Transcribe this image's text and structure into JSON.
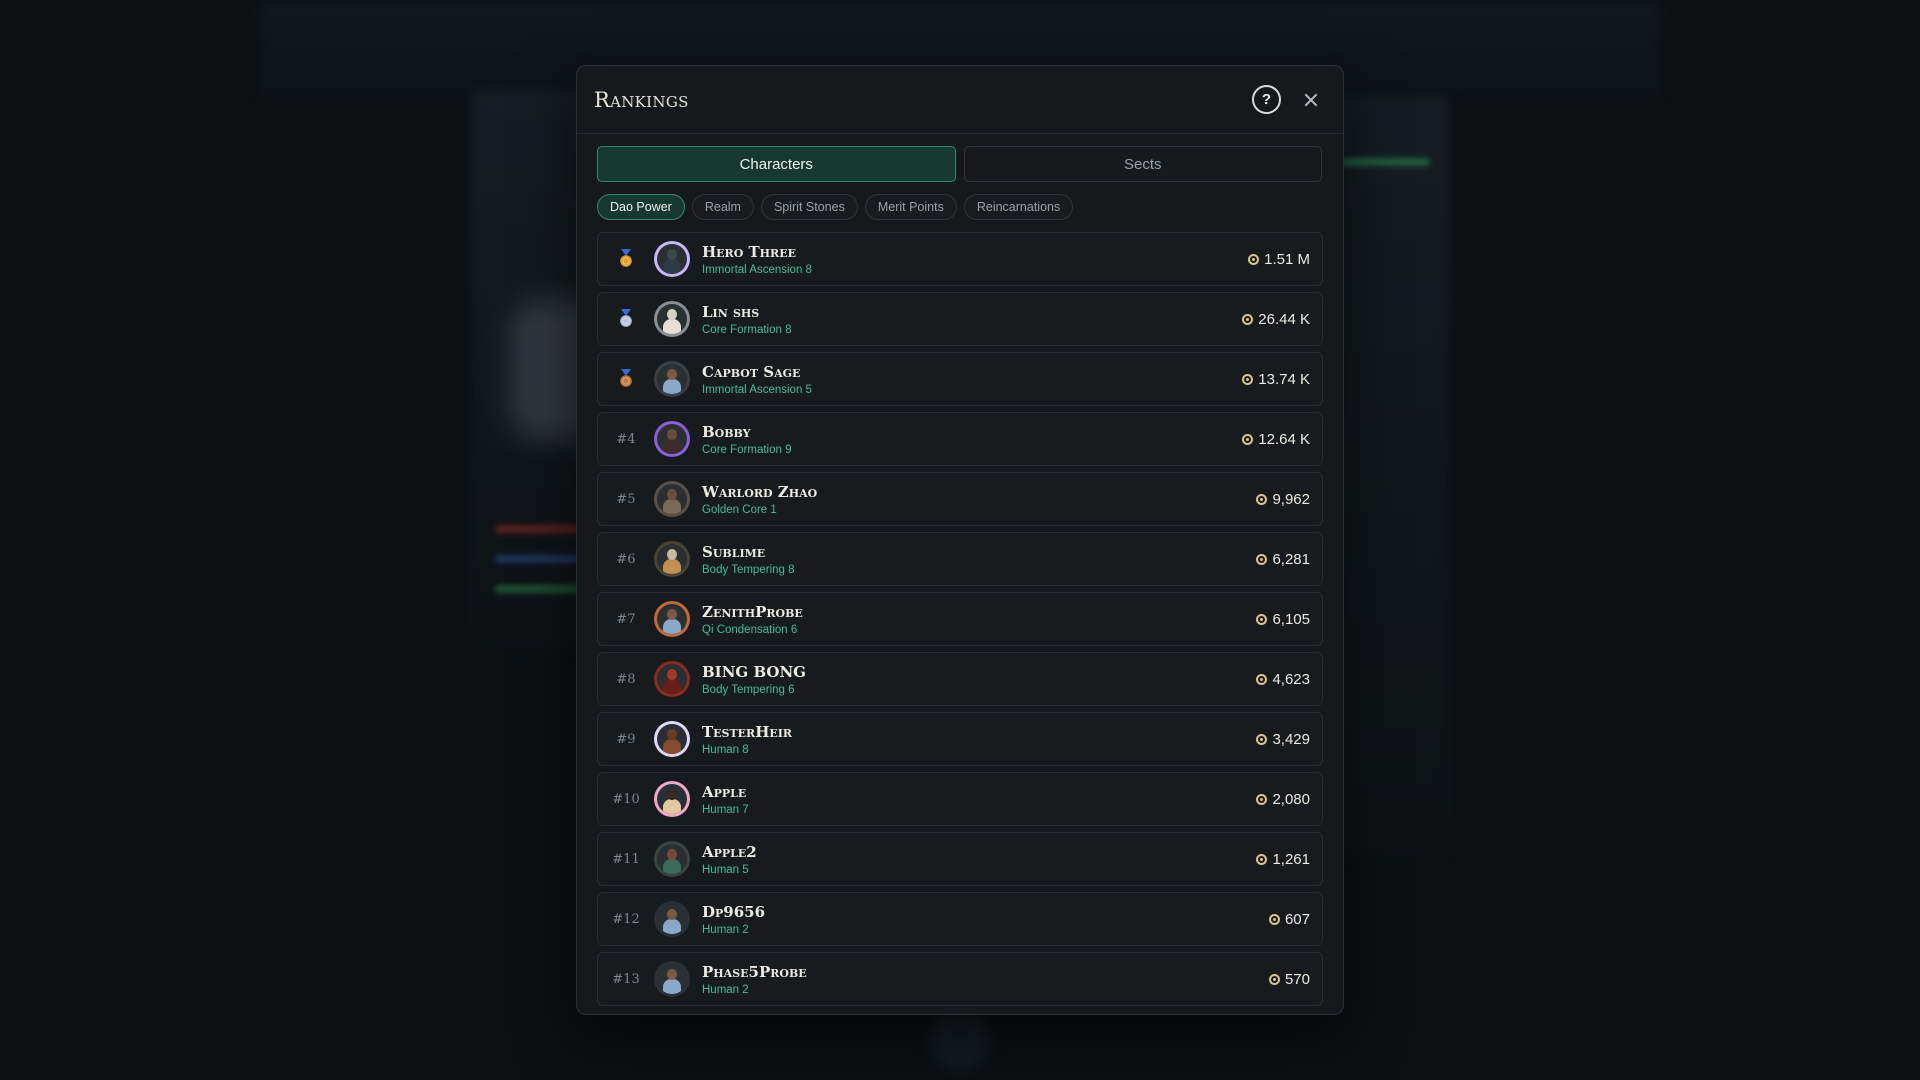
{
  "modal": {
    "title": "Rankings",
    "help_label": "?"
  },
  "main_tabs": [
    {
      "label": "Characters",
      "active": true
    },
    {
      "label": "Sects",
      "active": false
    }
  ],
  "sub_tabs": [
    {
      "label": "Dao Power",
      "active": true
    },
    {
      "label": "Realm",
      "active": false
    },
    {
      "label": "Spirit Stones",
      "active": false
    },
    {
      "label": "Merit Points",
      "active": false
    },
    {
      "label": "Reincarnations",
      "active": false
    }
  ],
  "colors": {
    "accent": "#2f8a6c",
    "realm_text": "#3fbf8f",
    "gold_medal": "#e0a030",
    "silver_medal": "#b8c4d8",
    "bronze_medal": "#c07840"
  },
  "rankings": [
    {
      "rank": "",
      "medal": "gold",
      "name": "Hero Three",
      "realm": "Immortal Ascension 8",
      "power": "1.51 M",
      "ring": "#c8b8ff",
      "head": "#3a4a4a",
      "body": "#2e3a46"
    },
    {
      "rank": "",
      "medal": "silver",
      "name": "Lin shs",
      "realm": "Core Formation 8",
      "power": "26.44 K",
      "ring": "#8a8f94",
      "head": "#d8d2c4",
      "body": "#e4e0d6"
    },
    {
      "rank": "",
      "medal": "bronze",
      "name": "Capbot Sage",
      "realm": "Immortal Ascension 5",
      "power": "13.74 K",
      "ring": "#3a3f44",
      "head": "#7a5a46",
      "body": "#8aa8c8"
    },
    {
      "rank": "#4",
      "medal": "",
      "name": "Bobby",
      "realm": "Core Formation 9",
      "power": "12.64 K",
      "ring": "#8a60d8",
      "head": "#6a4a3a",
      "body": "#3e2c2a"
    },
    {
      "rank": "#5",
      "medal": "",
      "name": "Warlord Zhao",
      "realm": "Golden Core 1",
      "power": "9,962",
      "ring": "#5a5048",
      "head": "#6a5040",
      "body": "#7a6a58"
    },
    {
      "rank": "#6",
      "medal": "",
      "name": "Sublime",
      "realm": "Body Tempering 8",
      "power": "6,281",
      "ring": "#4a4438",
      "head": "#c8b8a0",
      "body": "#c09050"
    },
    {
      "rank": "#7",
      "medal": "",
      "name": "ZenithProbe",
      "realm": "Qi Condensation 6",
      "power": "6,105",
      "ring": "#c06a3a",
      "head": "#7a5a46",
      "body": "#8aa8c8"
    },
    {
      "rank": "#8",
      "medal": "",
      "name": "BING BONG",
      "realm": "Body Tempering 6",
      "power": "4,623",
      "ring": "#8a2a20",
      "head": "#a03a28",
      "body": "#6a1e18"
    },
    {
      "rank": "#9",
      "medal": "",
      "name": "TesterHeir",
      "realm": "Human 8",
      "power": "3,429",
      "ring": "#e0d8ff",
      "head": "#6a3a28",
      "body": "#8a4a30"
    },
    {
      "rank": "#10",
      "medal": "",
      "name": "Apple",
      "realm": "Human 7",
      "power": "2,080",
      "ring": "#f0a8c8",
      "head": "#3a2a28",
      "body": "#e0c8a0"
    },
    {
      "rank": "#11",
      "medal": "",
      "name": "Apple2",
      "realm": "Human 5",
      "power": "1,261",
      "ring": "#3a4440",
      "head": "#7a4a38",
      "body": "#3a6a5a"
    },
    {
      "rank": "#12",
      "medal": "",
      "name": "Dp9656",
      "realm": "Human 2",
      "power": "607",
      "ring": "#2a3038",
      "head": "#7a5a46",
      "body": "#8aa8c8"
    },
    {
      "rank": "#13",
      "medal": "",
      "name": "Phase5Probe",
      "realm": "Human 2",
      "power": "570",
      "ring": "#2a3038",
      "head": "#7a5a46",
      "body": "#8aa8c8"
    }
  ]
}
